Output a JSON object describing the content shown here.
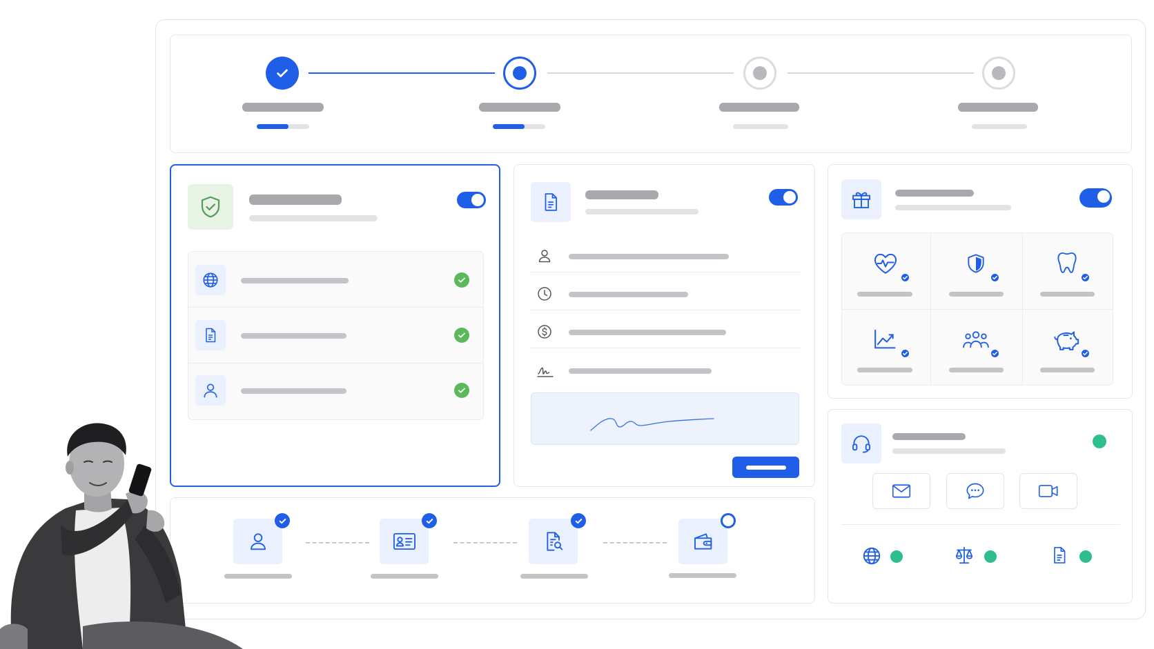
{
  "theme": {
    "accent": "#1f5ee6",
    "success": "#5cb85c",
    "online": "#2fbf8f",
    "placeholder": "#c4c4c8"
  },
  "stepper": {
    "steps": [
      {
        "state": "complete",
        "progress": 0.6
      },
      {
        "state": "current",
        "progress": 0.6
      },
      {
        "state": "upcoming",
        "progress": 0
      },
      {
        "state": "upcoming",
        "progress": 0
      }
    ]
  },
  "verification_card": {
    "icon": "shield-check-icon",
    "enabled": true,
    "items": [
      {
        "icon": "globe-icon",
        "status": "verified"
      },
      {
        "icon": "document-icon",
        "status": "verified"
      },
      {
        "icon": "user-icon",
        "status": "verified"
      }
    ]
  },
  "document_card": {
    "icon": "document-icon",
    "enabled": true,
    "fields": [
      {
        "icon": "user-icon"
      },
      {
        "icon": "clock-icon"
      },
      {
        "icon": "dollar-icon"
      },
      {
        "icon": "signature-icon"
      }
    ],
    "signature": "signature-pad"
  },
  "benefits_card": {
    "icon": "gift-icon",
    "enabled": true,
    "tiles": [
      {
        "icon": "heart-pulse-icon",
        "selected": true
      },
      {
        "icon": "shield-icon",
        "selected": true
      },
      {
        "icon": "tooth-icon",
        "selected": true
      },
      {
        "icon": "chart-up-icon",
        "selected": true
      },
      {
        "icon": "people-icon",
        "selected": true
      },
      {
        "icon": "piggy-bank-icon",
        "selected": true
      }
    ]
  },
  "support_card": {
    "icon": "headset-icon",
    "status": "online",
    "channels": [
      "mail-icon",
      "chat-icon",
      "video-icon"
    ],
    "services": [
      "globe-icon",
      "scale-icon",
      "document-icon"
    ]
  },
  "onboarding_flow": {
    "steps": [
      {
        "icon": "user-icon",
        "done": true
      },
      {
        "icon": "id-card-icon",
        "done": true
      },
      {
        "icon": "document-search-icon",
        "done": true
      },
      {
        "icon": "wallet-icon",
        "done": false
      }
    ]
  }
}
